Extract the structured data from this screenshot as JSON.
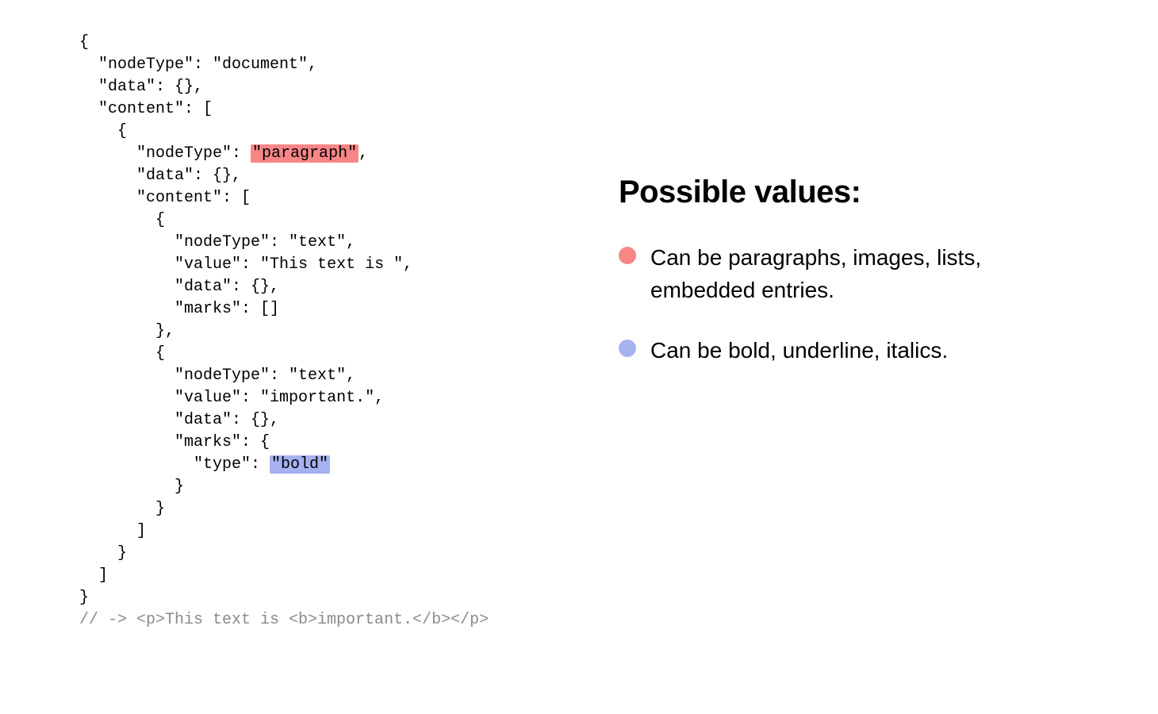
{
  "code": {
    "lines": [
      {
        "indent": 0,
        "segments": [
          {
            "t": "{"
          }
        ]
      },
      {
        "indent": 1,
        "segments": [
          {
            "t": "\"nodeType\": \"document\","
          }
        ]
      },
      {
        "indent": 1,
        "segments": [
          {
            "t": "\"data\": {},"
          }
        ]
      },
      {
        "indent": 1,
        "segments": [
          {
            "t": "\"content\": ["
          }
        ]
      },
      {
        "indent": 2,
        "segments": [
          {
            "t": "{"
          }
        ]
      },
      {
        "indent": 3,
        "segments": [
          {
            "t": "\"nodeType\": "
          },
          {
            "t": "\"paragraph\"",
            "hl": "red"
          },
          {
            "t": ","
          }
        ]
      },
      {
        "indent": 3,
        "segments": [
          {
            "t": "\"data\": {},"
          }
        ]
      },
      {
        "indent": 3,
        "segments": [
          {
            "t": "\"content\": ["
          }
        ]
      },
      {
        "indent": 4,
        "segments": [
          {
            "t": "{"
          }
        ]
      },
      {
        "indent": 5,
        "segments": [
          {
            "t": "\"nodeType\": \"text\","
          }
        ]
      },
      {
        "indent": 5,
        "segments": [
          {
            "t": "\"value\": \"This text is \","
          }
        ]
      },
      {
        "indent": 5,
        "segments": [
          {
            "t": "\"data\": {},"
          }
        ]
      },
      {
        "indent": 5,
        "segments": [
          {
            "t": "\"marks\": []"
          }
        ]
      },
      {
        "indent": 4,
        "segments": [
          {
            "t": "},"
          }
        ]
      },
      {
        "indent": 4,
        "segments": [
          {
            "t": "{"
          }
        ]
      },
      {
        "indent": 5,
        "segments": [
          {
            "t": "\"nodeType\": \"text\","
          }
        ]
      },
      {
        "indent": 5,
        "segments": [
          {
            "t": "\"value\": \"important.\","
          }
        ]
      },
      {
        "indent": 5,
        "segments": [
          {
            "t": "\"data\": {},"
          }
        ]
      },
      {
        "indent": 5,
        "segments": [
          {
            "t": "\"marks\": {"
          }
        ]
      },
      {
        "indent": 6,
        "segments": [
          {
            "t": "\"type\": "
          },
          {
            "t": "\"bold\"",
            "hl": "blue"
          }
        ]
      },
      {
        "indent": 5,
        "segments": [
          {
            "t": "}"
          }
        ]
      },
      {
        "indent": 4,
        "segments": [
          {
            "t": "}"
          }
        ]
      },
      {
        "indent": 3,
        "segments": [
          {
            "t": "]"
          }
        ]
      },
      {
        "indent": 2,
        "segments": [
          {
            "t": "}"
          }
        ]
      },
      {
        "indent": 1,
        "segments": [
          {
            "t": "]"
          }
        ]
      },
      {
        "indent": 0,
        "segments": [
          {
            "t": "}"
          }
        ]
      },
      {
        "indent": 0,
        "segments": [
          {
            "t": "// -> <p>This text is <b>important.</b></p>",
            "cls": "comment"
          }
        ]
      }
    ]
  },
  "panel": {
    "heading": "Possible values:",
    "items": [
      {
        "text": "Can be paragraphs, images, lists,  embedded entries.",
        "dot": "red"
      },
      {
        "text": "Can be bold, underline, italics.",
        "dot": "blue"
      }
    ]
  },
  "colors": {
    "highlight_red": "#f88686",
    "highlight_blue": "#a6b1f0",
    "comment_grey": "#8a8a8a"
  }
}
